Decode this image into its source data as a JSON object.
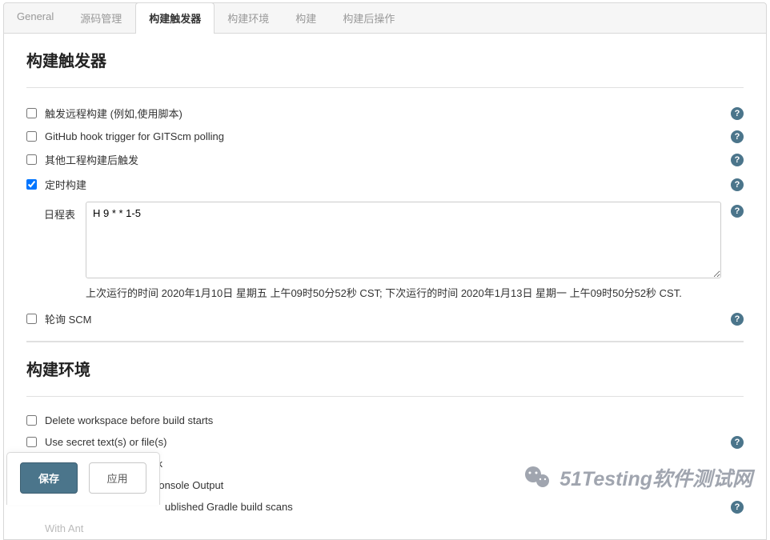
{
  "tabs": {
    "general": "General",
    "scm": "源码管理",
    "triggers": "构建触发器",
    "env": "构建环境",
    "build": "构建",
    "post": "构建后操作"
  },
  "triggers_section": {
    "title": "构建触发器",
    "opt_remote": "触发远程构建 (例如,使用脚本)",
    "opt_github": "GitHub hook trigger for GITScm polling",
    "opt_after_other": "其他工程构建后触发",
    "opt_timer": "定时构建",
    "opt_poll_scm": "轮询 SCM",
    "schedule_label": "日程表",
    "schedule_value": "H 9 * * 1-5",
    "schedule_info": "上次运行的时间 2020年1月10日 星期五 上午09时50分52秒 CST; 下次运行的时间 2020年1月13日 星期一 上午09时50分52秒 CST."
  },
  "env_section": {
    "title": "构建环境",
    "opt_delete_ws": "Delete workspace before build starts",
    "opt_secret": "Use secret text(s) or file(s)",
    "opt_abort": "Abort the build if it's stuck",
    "opt_timestamps": "Add timestamps to the Console Output",
    "opt_gradle": "ublished Gradle build scans",
    "opt_ant": "With Ant"
  },
  "buttons": {
    "save": "保存",
    "apply": "应用"
  },
  "watermark": "51Testing软件测试网",
  "help_char": "?"
}
